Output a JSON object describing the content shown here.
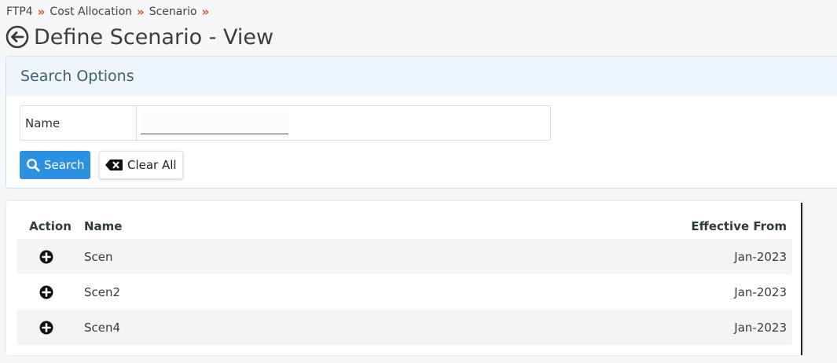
{
  "breadcrumb": {
    "items": [
      "FTP4",
      "Cost Allocation",
      "Scenario"
    ],
    "separator": "»"
  },
  "header": {
    "title": "Define Scenario - View",
    "back_icon": "back-arrow-circle-icon"
  },
  "search": {
    "panel_title": "Search Options",
    "name_label": "Name",
    "name_value": "",
    "name_placeholder": "",
    "search_button_label": "Search",
    "search_icon": "magnifier-icon",
    "clear_button_label": "Clear All",
    "clear_icon": "backspace-icon"
  },
  "table": {
    "columns": {
      "action": "Action",
      "name": "Name",
      "effective_from": "Effective From"
    },
    "rows": [
      {
        "name": "Scen",
        "effective_from": "Jan-2023"
      },
      {
        "name": "Scen2",
        "effective_from": "Jan-2023"
      },
      {
        "name": "Scen4",
        "effective_from": "Jan-2023"
      }
    ],
    "row_action_icon": "plus-circle-icon"
  },
  "colors": {
    "accent": "#2b91e0",
    "breadcrumb_separator": "#d9502a",
    "panel_header_bg": "#eef6fc"
  }
}
